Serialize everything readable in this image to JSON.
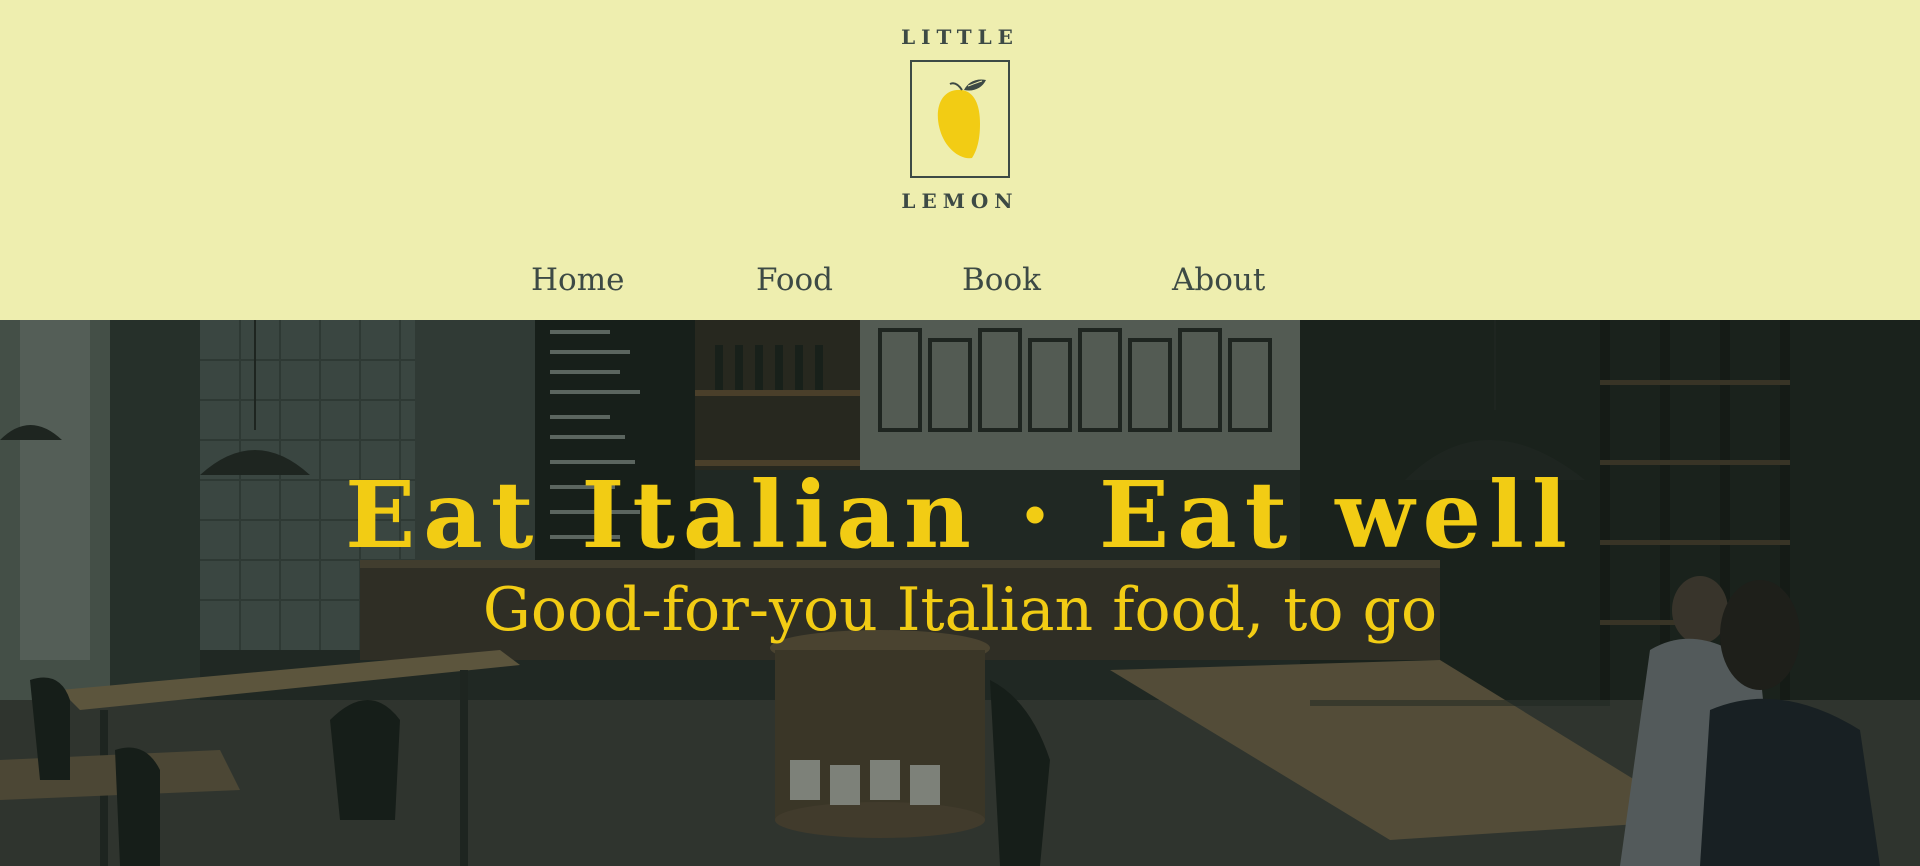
{
  "brand": {
    "top_word": "LITTLE",
    "bottom_word": "LEMON",
    "logo_icon": "lemon-icon",
    "ink_color": "#3d4a45",
    "lemon_color": "#f2cc14"
  },
  "nav": {
    "items": [
      {
        "label": "Home"
      },
      {
        "label": "Food"
      },
      {
        "label": "Book"
      },
      {
        "label": "About"
      }
    ]
  },
  "hero": {
    "title": "Eat Italian · Eat well",
    "subtitle": "Good-for-you Italian food, to go",
    "background": "cafe-interior-photo",
    "text_color": "#f2cc14"
  },
  "colors": {
    "header_bg": "#eeeeaf",
    "accent": "#f2cc14",
    "ink": "#3d4a45"
  }
}
